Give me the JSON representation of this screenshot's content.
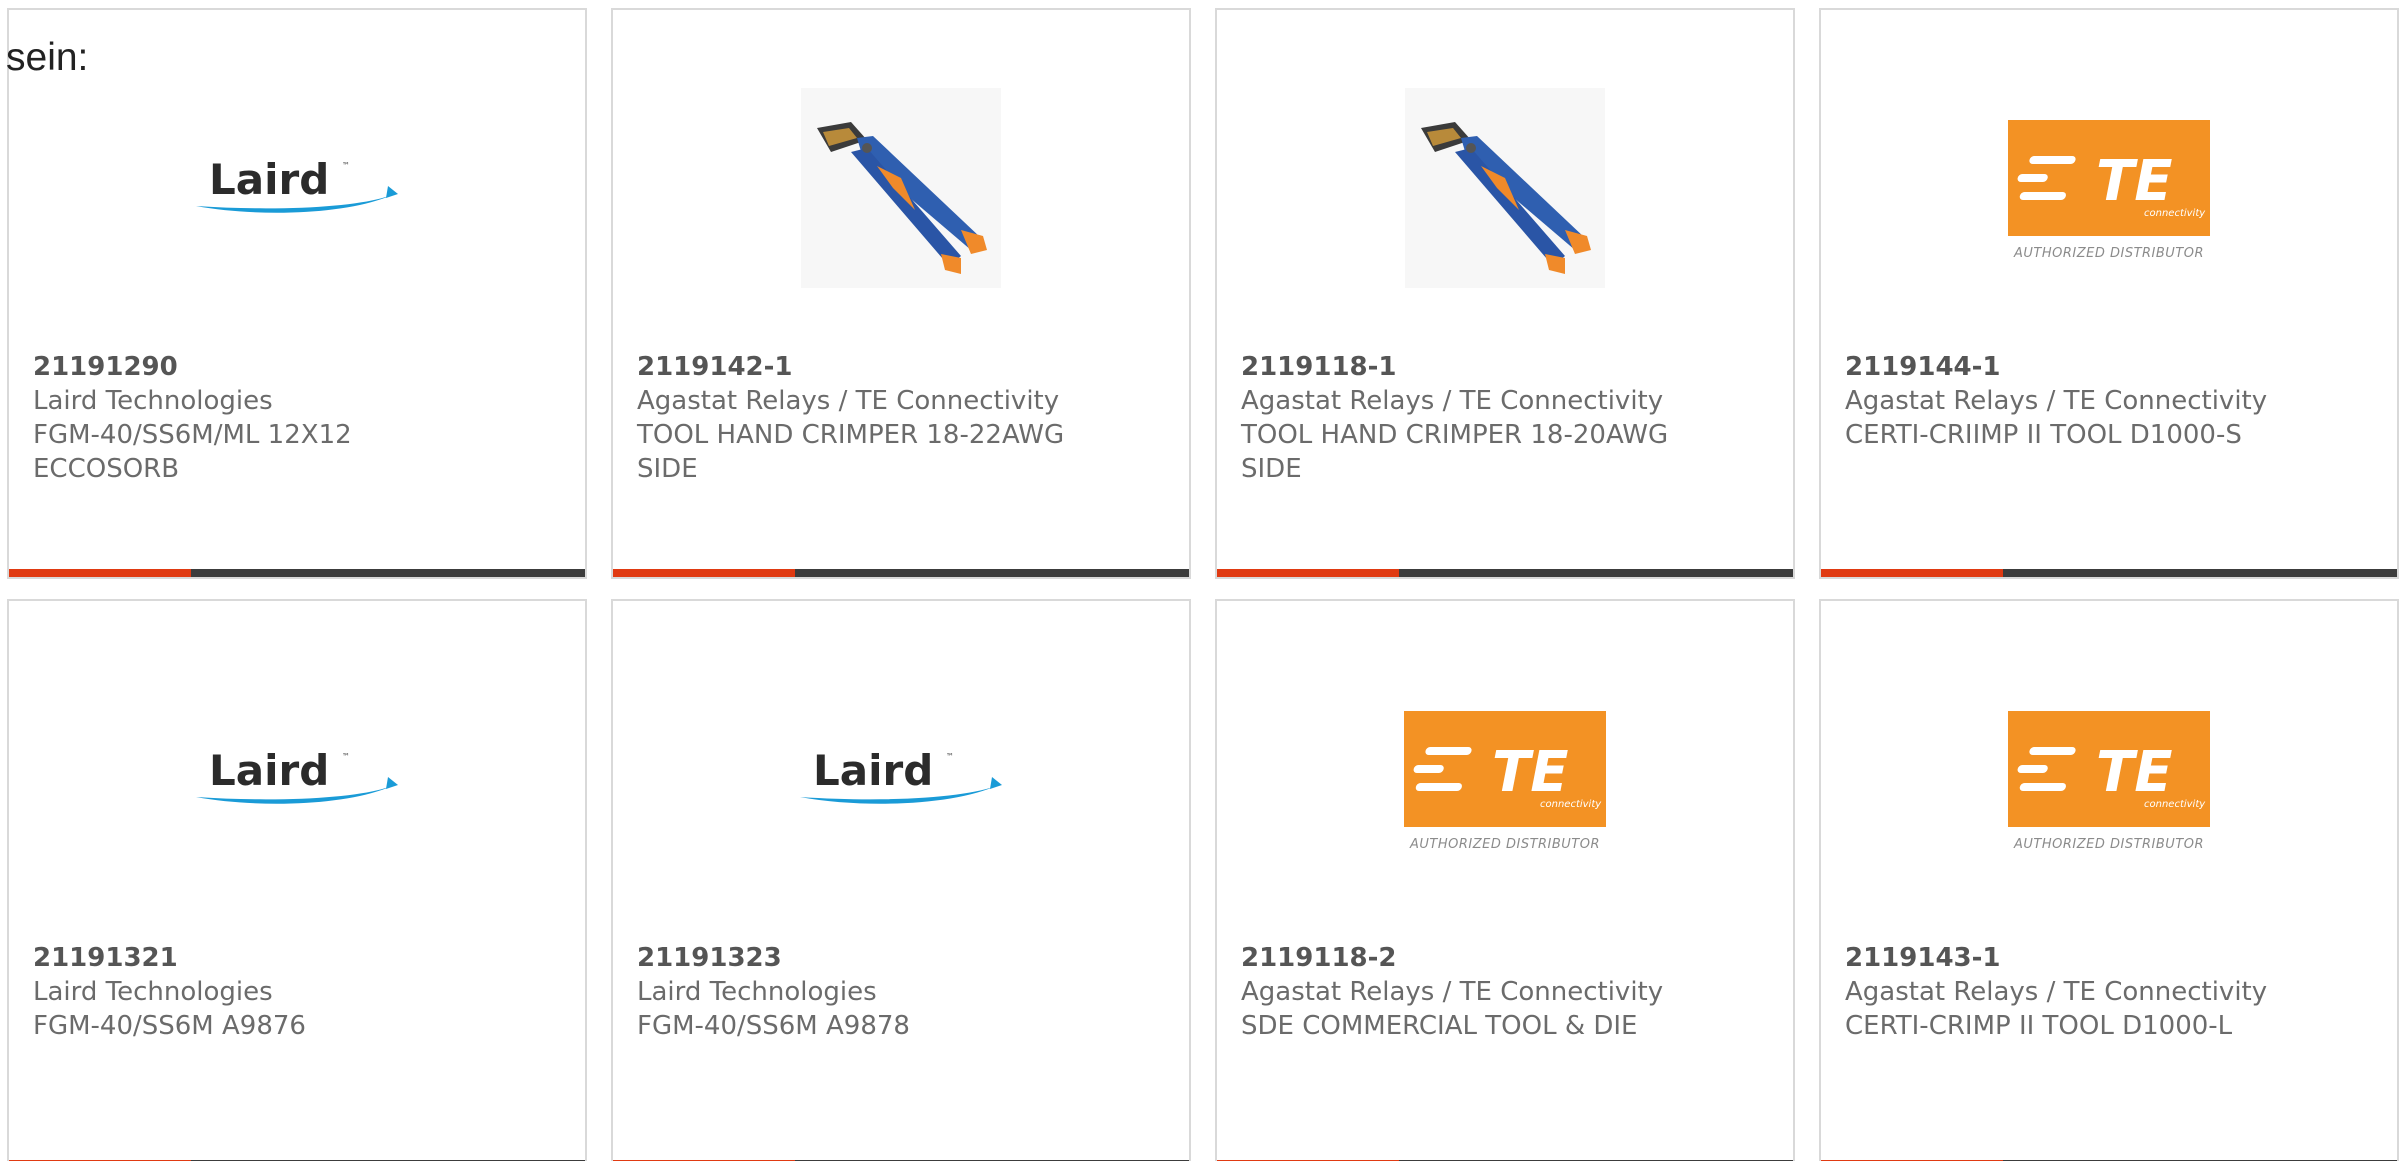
{
  "intro_text": "sein:",
  "colors": {
    "accent": "#e03a12",
    "bar": "#3c3c3c",
    "te_orange": "#f39224",
    "laird_blue": "#1a9bd7"
  },
  "products": [
    {
      "part_number": "21191290",
      "manufacturer": "Laird Technologies",
      "description_lines": [
        "FGM-40/SS6M/ML 12X12",
        "ECCOSORB"
      ],
      "image": "laird-logo"
    },
    {
      "part_number": "2119142-1",
      "manufacturer": "Agastat Relays / TE Connectivity",
      "description_lines": [
        "TOOL HAND CRIMPER 18-22AWG",
        "SIDE"
      ],
      "image": "crimper-tool-photo"
    },
    {
      "part_number": "2119118-1",
      "manufacturer": "Agastat Relays / TE Connectivity",
      "description_lines": [
        "TOOL HAND CRIMPER 18-20AWG",
        "SIDE"
      ],
      "image": "crimper-tool-photo"
    },
    {
      "part_number": "2119144-1",
      "manufacturer": "Agastat Relays / TE Connectivity",
      "description_lines": [
        "CERTI-CRIIMP II TOOL D1000-S"
      ],
      "image": "te-connectivity-logo"
    },
    {
      "part_number": "21191321",
      "manufacturer": "Laird Technologies",
      "description_lines": [
        "FGM-40/SS6M A9876"
      ],
      "image": "laird-logo"
    },
    {
      "part_number": "21191323",
      "manufacturer": "Laird Technologies",
      "description_lines": [
        "FGM-40/SS6M A9878"
      ],
      "image": "laird-logo"
    },
    {
      "part_number": "2119118-2",
      "manufacturer": "Agastat Relays / TE Connectivity",
      "description_lines": [
        "SDE COMMERCIAL TOOL & DIE"
      ],
      "image": "te-connectivity-logo"
    },
    {
      "part_number": "2119143-1",
      "manufacturer": "Agastat Relays / TE Connectivity",
      "description_lines": [
        "CERTI-CRIMP II TOOL D1000-L"
      ],
      "image": "te-connectivity-logo"
    }
  ],
  "logos": {
    "laird": "Laird",
    "te_main": "TE",
    "te_small": "connectivity",
    "te_sub": "AUTHORIZED DISTRIBUTOR"
  }
}
